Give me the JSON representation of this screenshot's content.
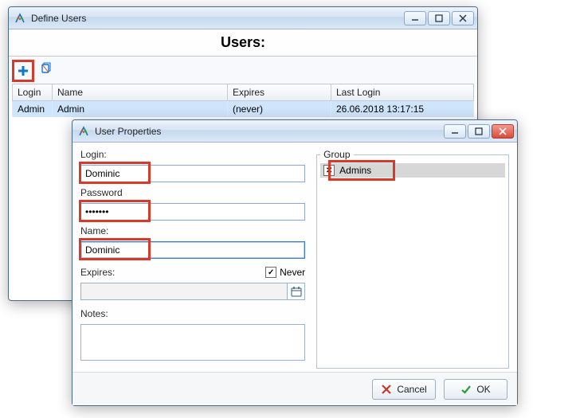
{
  "define_users_window": {
    "title": "Define Users",
    "header": "Users:",
    "columns": {
      "login": "Login",
      "name": "Name",
      "expires": "Expires",
      "last_login": "Last Login"
    },
    "rows": [
      {
        "login": "Admin",
        "name": "Admin",
        "expires": "(never)",
        "last_login": "26.06.2018 13:17:15",
        "selected": true
      }
    ]
  },
  "user_properties_window": {
    "title": "User Properties",
    "labels": {
      "login": "Login:",
      "password": "Password",
      "name": "Name:",
      "expires": "Expires:",
      "never": "Never",
      "notes": "Notes:",
      "group": "Group"
    },
    "values": {
      "login": "Dominic",
      "password": "*******",
      "name": "Dominic",
      "expires": "",
      "notes": "",
      "never_checked": true
    },
    "groups": [
      {
        "name": "Admins",
        "checked": true
      }
    ],
    "buttons": {
      "cancel": "Cancel",
      "ok": "OK"
    }
  }
}
